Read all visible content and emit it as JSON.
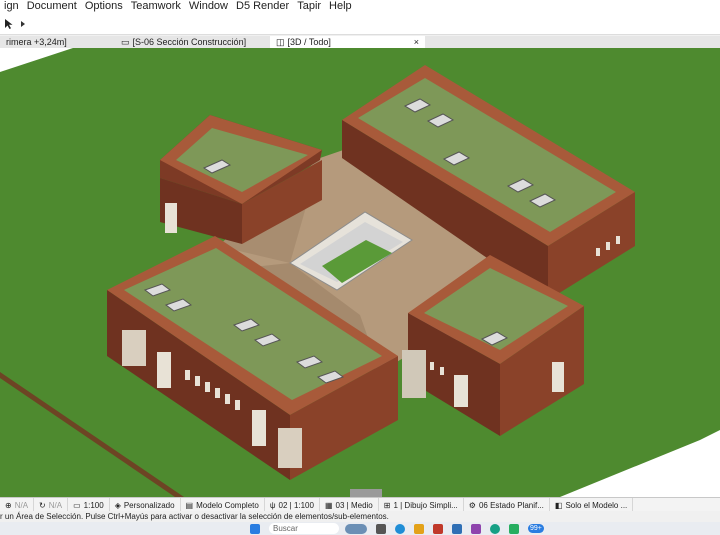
{
  "menu": [
    "ign",
    "Document",
    "Options",
    "Teamwork",
    "Window",
    "D5 Render",
    "Tapir",
    "Help"
  ],
  "tabs": [
    {
      "label": "rimera +3,24m]"
    },
    {
      "label": "[S-06 Sección Construcción]"
    },
    {
      "label": "[3D / Todo]",
      "close": "×"
    }
  ],
  "nav": {
    "na1": "N/A",
    "na2": "N/A",
    "scale": "1:100",
    "personalizado": "Personalizado",
    "modelo": "Modelo Completo",
    "pen": "02 | 1:100",
    "medio": "03 | Medio",
    "dibujo": "1 | Dibujo Simpli...",
    "estado": "06 Estado Planif...",
    "solo": "Solo el Modelo ..."
  },
  "status_text": "r un Área de Selección. Pulse Ctrl+Mayús para activar o desactivar la selección de elementos/sub-elementos.",
  "taskbar": {
    "search_placeholder": "Buscar",
    "badge": "99+"
  },
  "colors": {
    "grass": "#4e8a2f",
    "grass_dark": "#3f7226",
    "soil": "#6d4424",
    "brick_front": "#7d3a25",
    "brick_side": "#9a4a2f",
    "brick_top": "#a85a3a",
    "roof": "#7e9858",
    "deck": "#b59a7c",
    "deck_dark": "#9c8266"
  }
}
